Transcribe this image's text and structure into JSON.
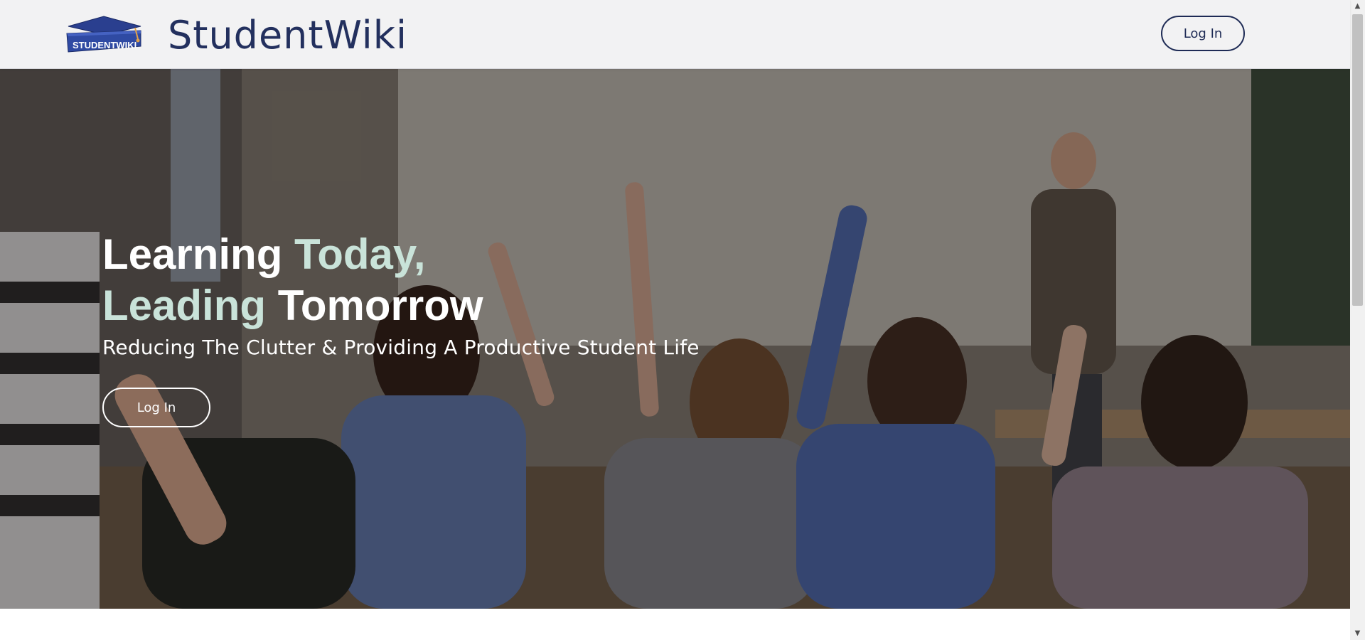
{
  "header": {
    "logo_text": "STUDENTWIKI",
    "brand_name": "StudentWiki",
    "login_label": "Log In"
  },
  "hero": {
    "title_line1_a": "Learning ",
    "title_line1_b": "Today,",
    "title_line2_a": "Leading ",
    "title_line2_b": "Tomorrow",
    "subtitle": "Reducing The Clutter & Providing A Productive Student Life",
    "login_label": "Log In"
  },
  "colors": {
    "brand_navy": "#23305e",
    "accent_mint": "#c9e3d9",
    "header_bg": "#f2f2f3"
  },
  "icons": {
    "logo": "graduation-cap-logo",
    "scroll_up": "arrow-up-icon",
    "scroll_down": "arrow-down-icon"
  }
}
